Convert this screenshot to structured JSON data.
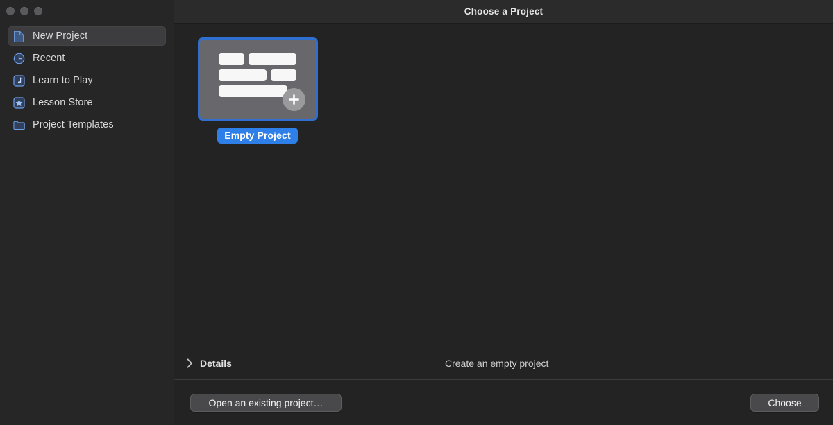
{
  "window": {
    "title": "Choose a Project",
    "traffic_lights": [
      "close-button",
      "minimize-button",
      "zoom-button"
    ]
  },
  "sidebar": {
    "items": [
      {
        "label": "New Project",
        "icon": "document-icon",
        "selected": true
      },
      {
        "label": "Recent",
        "icon": "clock-icon",
        "selected": false
      },
      {
        "label": "Learn to Play",
        "icon": "music-note-icon",
        "selected": false
      },
      {
        "label": "Lesson Store",
        "icon": "star-icon",
        "selected": false
      },
      {
        "label": "Project Templates",
        "icon": "folder-icon",
        "selected": false
      }
    ]
  },
  "main": {
    "projects": [
      {
        "label": "Empty Project",
        "selected": true,
        "thumbnail_icon": "track-bars-plus-icon"
      }
    ]
  },
  "details": {
    "toggle_label": "Details",
    "chevron": "chevron-right-icon",
    "expanded": false,
    "description": "Create an empty project"
  },
  "footer": {
    "open_existing_label": "Open an existing project…",
    "choose_label": "Choose"
  },
  "colors": {
    "accent_blue": "#2f7fe8",
    "selection_border": "#2f6fd0",
    "sidebar_bg": "#262627",
    "content_bg": "#232324",
    "titlebar_bg": "#2b2b2c",
    "button_bg": "#49494b",
    "thumb_bg": "#68686c"
  }
}
